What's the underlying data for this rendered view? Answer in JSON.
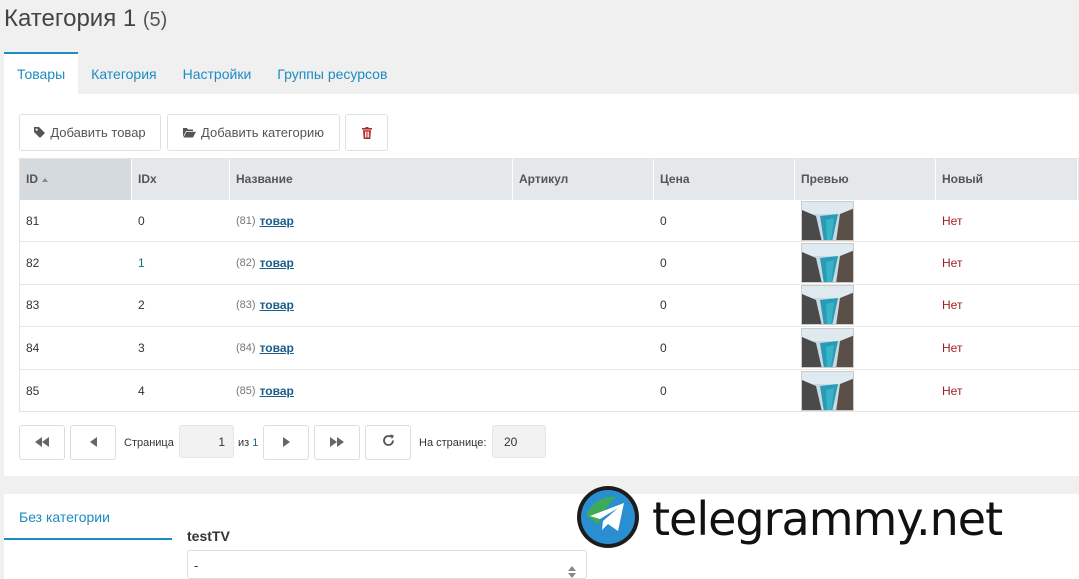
{
  "header": {
    "title": "Категория 1",
    "count": "(5)"
  },
  "tabs": [
    {
      "label": "Товары",
      "active": true
    },
    {
      "label": "Категория",
      "active": false
    },
    {
      "label": "Настройки",
      "active": false
    },
    {
      "label": "Группы ресурсов",
      "active": false
    }
  ],
  "toolbar": {
    "add_product_label": "Добавить товар",
    "add_category_label": "Добавить категорию"
  },
  "grid": {
    "columns": [
      "ID",
      "IDx",
      "Название",
      "Артикул",
      "Цена",
      "Превью",
      "Новый"
    ],
    "rows": [
      {
        "id": "81",
        "idx": "0",
        "pid": "(81)",
        "name": "товар",
        "article": "",
        "price": "0",
        "new": "Нет"
      },
      {
        "id": "82",
        "idx": "1",
        "pid": "(82)",
        "name": "товар",
        "article": "",
        "price": "0",
        "new": "Нет"
      },
      {
        "id": "83",
        "idx": "2",
        "pid": "(83)",
        "name": "товар",
        "article": "",
        "price": "0",
        "new": "Нет"
      },
      {
        "id": "84",
        "idx": "3",
        "pid": "(84)",
        "name": "товар",
        "article": "",
        "price": "0",
        "new": "Нет"
      },
      {
        "id": "85",
        "idx": "4",
        "pid": "(85)",
        "name": "товар",
        "article": "",
        "price": "0",
        "new": "Нет"
      }
    ]
  },
  "pagination": {
    "page_label": "Страница",
    "page_value": "1",
    "of_label": "из",
    "total_pages": "1",
    "per_page_label": "На странице:",
    "per_page_value": "20"
  },
  "bottom": {
    "tab_label": "Без категории",
    "tv_label": "testTV",
    "tv_value": "-"
  },
  "watermark": {
    "text": "telegrammy.net"
  },
  "colors": {
    "accent": "#1e8bc3",
    "link": "#1b5c8a",
    "no": "#a31d1d",
    "header_bg": "#e5e8eb"
  }
}
